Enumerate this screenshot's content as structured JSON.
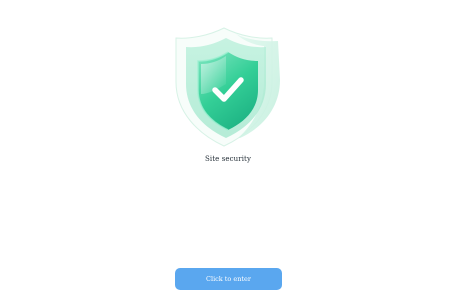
{
  "main": {
    "title": "Site security",
    "shield_icon": "shield-check-icon"
  },
  "action": {
    "enter_label": "Click to enter"
  },
  "colors": {
    "shield_green": "#3fd3a0",
    "button_blue": "#5aa7ef"
  }
}
